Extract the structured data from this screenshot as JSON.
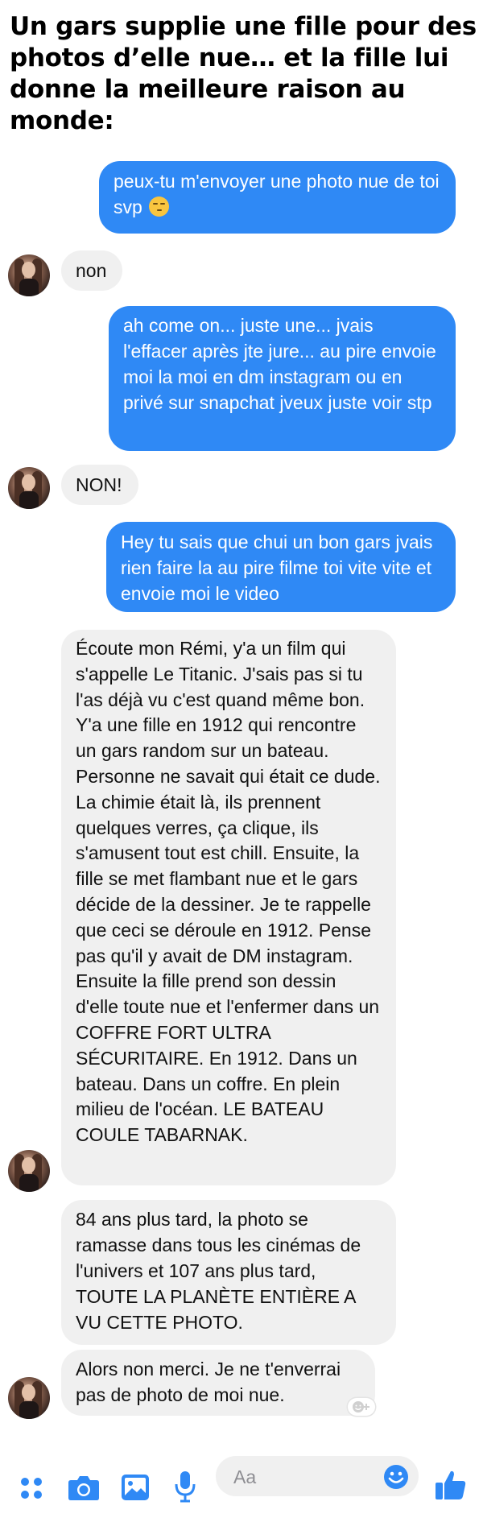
{
  "headline": "Un gars supplie une fille pour des photos d’elle nue… et la fille lui donne la meilleure raison au monde:",
  "messages": [
    {
      "from": "me",
      "text": "peux-tu m'envoyer une photo nue de toi svp",
      "emoji": "smirking-face"
    },
    {
      "from": "her",
      "text": "non"
    },
    {
      "from": "me",
      "text": "ah come on... juste une... jvais l'effacer après jte jure... au pire envoie moi la moi en dm instagram ou en privé sur snapchat jveux juste voir stp"
    },
    {
      "from": "her",
      "text": "NON!"
    },
    {
      "from": "me",
      "text": "Hey tu sais que chui un bon gars jvais rien faire la au pire filme toi vite vite et envoie moi le video"
    },
    {
      "from": "her",
      "text": "Écoute mon Rémi, y'a un film qui s'appelle Le Titanic. J'sais pas si tu l'as déjà vu c'est quand même bon. Y'a une fille en 1912 qui rencontre un gars random sur un bateau. Personne ne savait qui était ce dude. La chimie était là, ils prennent quelques verres, ça clique, ils s'amusent tout est chill. Ensuite, la fille se met flambant nue et le gars décide de la dessiner. Je te rappelle que ceci se déroule en 1912. Pense pas qu'il y avait de DM instagram. Ensuite la fille prend son dessin d'elle toute nue et l'enfermer dans un COFFRE FORT ULTRA SÉCURITAIRE. En 1912. Dans un bateau. Dans un coffre. En plein milieu de l'océan. LE BATEAU COULE TABARNAK."
    },
    {
      "from": "her",
      "text": "84 ans plus tard, la photo se ramasse dans tous les cinémas de l'univers et 107 ans plus tard, TOUTE LA PLANÈTE ENTIÈRE A VU CETTE PHOTO."
    },
    {
      "from": "her",
      "text": "Alors non merci. Je ne t'enverrai pas de photo de moi nue."
    }
  ],
  "composer": {
    "placeholder": "Aa"
  },
  "colors": {
    "sent_bubble": "#2f89f5",
    "received_bubble": "#f0f0f0",
    "icon_blue": "#2f89f5"
  },
  "toolbar_icons": [
    "more-icon",
    "camera-icon",
    "gallery-icon",
    "microphone-icon",
    "emoji-icon",
    "thumbs-up-icon"
  ]
}
